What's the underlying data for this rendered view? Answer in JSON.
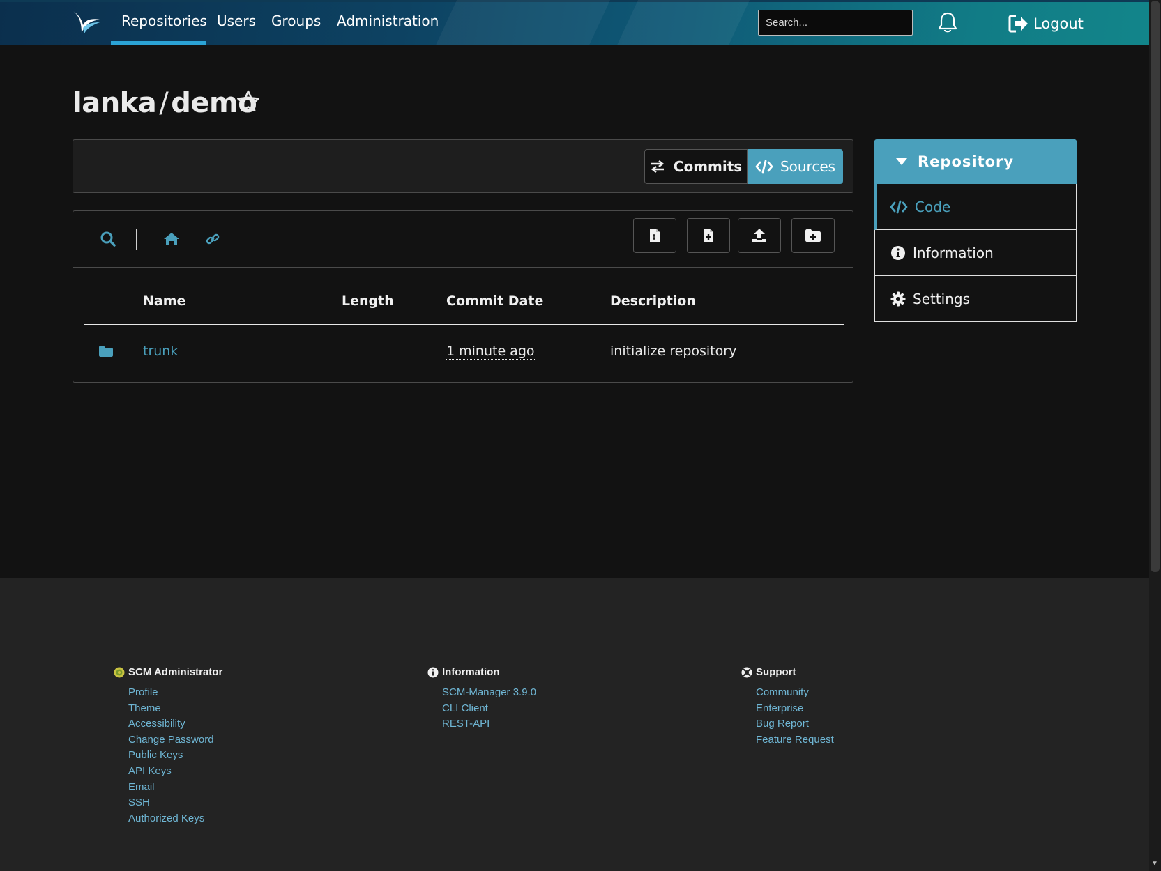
{
  "nav": {
    "items": [
      "Repositories",
      "Users",
      "Groups",
      "Administration"
    ],
    "active": "Repositories",
    "search_placeholder": "Search...",
    "logout_label": "Logout"
  },
  "repo": {
    "namespace": "lanka",
    "separator": "/",
    "name": "demo"
  },
  "branch_panel": {
    "commits_label": "Commits",
    "sources_label": "Sources"
  },
  "table": {
    "headers": [
      "Name",
      "Length",
      "Commit Date",
      "Description"
    ],
    "rows": [
      {
        "name": "trunk",
        "length": "",
        "commit_date": "1 minute ago",
        "description": "initialize repository",
        "type": "folder"
      }
    ]
  },
  "sidebar": {
    "header": "Repository",
    "items": [
      "Code",
      "Information",
      "Settings"
    ],
    "active": "Code"
  },
  "footer": {
    "columns": [
      {
        "title": "SCM Administrator",
        "links": [
          "Profile",
          "Theme",
          "Accessibility",
          "Change Password",
          "Public Keys",
          "API Keys",
          "Email",
          "SSH",
          "Authorized Keys"
        ]
      },
      {
        "title": "Information",
        "links": [
          "SCM-Manager 3.9.0",
          "CLI Client",
          "REST-API"
        ]
      },
      {
        "title": "Support",
        "links": [
          "Community",
          "Enterprise",
          "Bug Report",
          "Feature Request"
        ]
      }
    ]
  },
  "colors": {
    "accent": "#4aa0bc",
    "link": "#6fb6d4",
    "background": "#121212",
    "footer": "#232323"
  },
  "icons": [
    "logo-icon",
    "bell-icon",
    "logout-icon",
    "star-icon",
    "commits-icon",
    "code-icon",
    "search-icon",
    "home-icon",
    "link-icon",
    "file-icon",
    "file-add-icon",
    "upload-icon",
    "folder-add-icon",
    "folder-icon",
    "caret-down-icon",
    "info-icon",
    "gear-icon",
    "user-icon",
    "support-icon"
  ]
}
